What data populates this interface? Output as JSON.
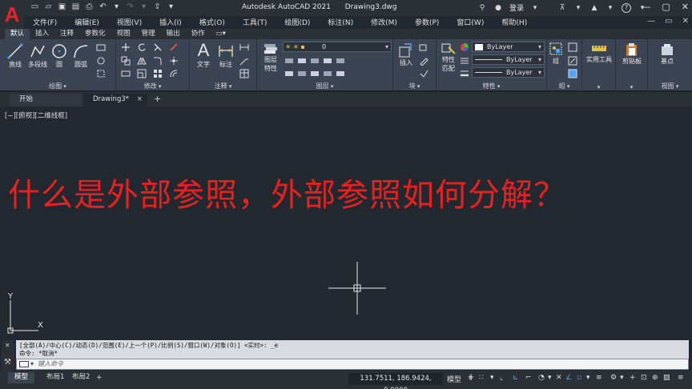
{
  "window": {
    "logo_letter": "A",
    "app_title": "Autodesk AutoCAD 2021",
    "file_name": "Drawing3.dwg",
    "sign_in": "登录"
  },
  "menu": [
    "文件(F)",
    "编辑(E)",
    "视图(V)",
    "插入(I)",
    "格式(O)",
    "工具(T)",
    "绘图(D)",
    "标注(N)",
    "修改(M)",
    "参数(P)",
    "窗口(W)",
    "帮助(H)"
  ],
  "ribbon_tabs": [
    {
      "label": "默认",
      "active": true
    },
    {
      "label": "插入",
      "active": false
    },
    {
      "label": "注释",
      "active": false
    },
    {
      "label": "参数化",
      "active": false
    },
    {
      "label": "视图",
      "active": false
    },
    {
      "label": "管理",
      "active": false
    },
    {
      "label": "输出",
      "active": false
    },
    {
      "label": "协作",
      "active": false
    },
    {
      "label": "▭▾",
      "active": false
    }
  ],
  "panels": {
    "draw": {
      "title": "绘图",
      "line": "直线",
      "polyline": "多段线",
      "circle": "圆",
      "arc": "圆弧"
    },
    "modify": {
      "title": "修改"
    },
    "annotation": {
      "title": "注释",
      "text": "文字",
      "dimension": "标注"
    },
    "layers": {
      "title": "图层",
      "layer_props": "图层特性",
      "layer_props_line1": "图层",
      "layer_props_line2": "特性",
      "current_layer": "0"
    },
    "block": {
      "title": "块",
      "insert": "插入"
    },
    "properties": {
      "title": "特性",
      "match_line1": "特性",
      "match_line2": "匹配",
      "color": "ByLayer",
      "linetype": "ByLayer",
      "lineweight": "ByLayer"
    },
    "groups": {
      "title": "组",
      "group": "组"
    },
    "utilities": {
      "title": "",
      "label": "实用工具"
    },
    "clipboard": {
      "title": "",
      "label": "剪贴板"
    },
    "view": {
      "title": "视图",
      "base": "基点"
    }
  },
  "doc_tabs": {
    "start": "开始",
    "drawing": "Drawing3*",
    "close": "×",
    "add": "+"
  },
  "canvas": {
    "view_label": "[−][俯视][二维线框]",
    "headline": "什么是外部参照，外部参照如何分解？",
    "ucs_x": "X",
    "ucs_y": "Y"
  },
  "command": {
    "history_line1": "[全部(A)/中心(C)/动态(D)/范围(E)/上一个(P)/比例(S)/窗口(W)/对象(O)] <实时>: _e",
    "history_line2": "命令: *取消*",
    "placeholder": "键入命令"
  },
  "status": {
    "layouts": [
      {
        "label": "模型",
        "active": true
      },
      {
        "label": "布局1",
        "active": false
      },
      {
        "label": "布局2",
        "active": false
      }
    ],
    "add_layout": "+",
    "coordinates": "131.7511, 186.9424, 0.0000",
    "model_label": "模型"
  },
  "colors": {
    "headline": "#e8211e",
    "ribbon_bg": "#3b4453",
    "canvas_bg": "#212830",
    "accent_blue": "#4ea3ff",
    "logo_red": "#e0252b"
  }
}
